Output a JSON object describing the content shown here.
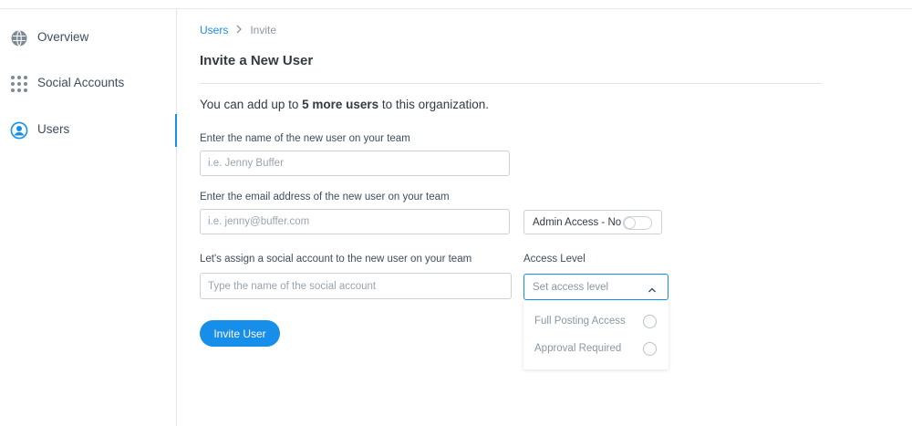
{
  "sidebar": {
    "items": [
      {
        "label": "Overview",
        "icon": "globe-icon",
        "active": false
      },
      {
        "label": "Social Accounts",
        "icon": "grid-dots-icon",
        "active": false
      },
      {
        "label": "Users",
        "icon": "user-circle-icon",
        "active": true
      }
    ]
  },
  "breadcrumb": {
    "parent": "Users",
    "separator": ">",
    "current": "Invite"
  },
  "page": {
    "title": "Invite a New User",
    "intro_prefix": "You can add up to ",
    "intro_bold": "5 more users",
    "intro_suffix": " to this organization."
  },
  "form": {
    "name": {
      "label": "Enter the name of the new user on your team",
      "placeholder": "i.e. Jenny Buffer",
      "value": ""
    },
    "email": {
      "label": "Enter the email address of the new user on your team",
      "placeholder": "i.e. jenny@buffer.com",
      "value": ""
    },
    "admin_toggle": {
      "label": "Admin Access - No",
      "on": false
    },
    "social_account": {
      "label": "Let's assign a social account to the new user on your team",
      "placeholder": "Type the name of the social account",
      "value": ""
    },
    "access_level": {
      "label": "Access Level",
      "placeholder": "Set access level",
      "options": [
        "Full Posting Access",
        "Approval Required"
      ]
    },
    "submit_label": "Invite User"
  },
  "colors": {
    "accent": "#168eea",
    "text": "#3d4e5e",
    "muted": "#8a97a3",
    "border": "#ccd2d8"
  }
}
